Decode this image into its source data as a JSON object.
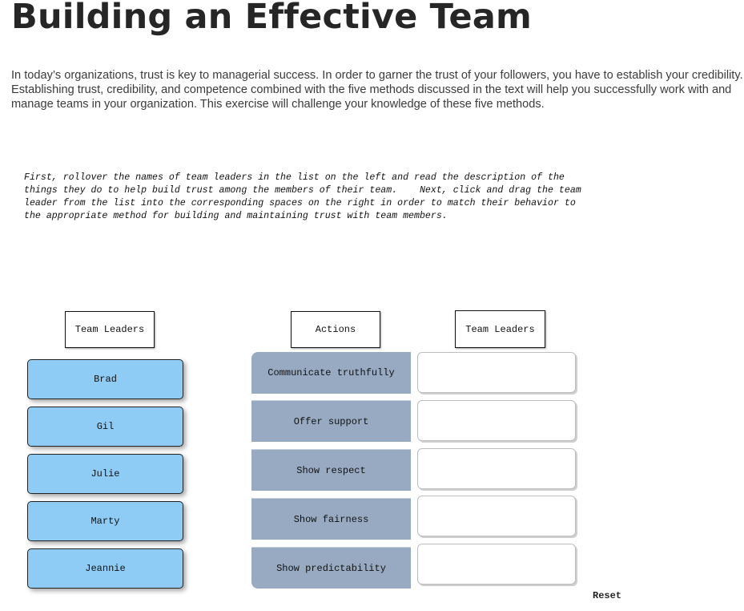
{
  "page": {
    "title": "Building an Effective Team",
    "intro": "In today’s organizations, trust is key to managerial success. In order to garner the trust of your followers, you have to establish your credibility. Establishing trust, credibility, and competence combined with the five methods discussed in the text will help you successfully work with and manage teams in your organization. This exercise will challenge your knowledge of these five methods.",
    "instructions": "First, rollover the names of team leaders in the list on the left and read the description of the\nthings they do to help build trust among the members of their team.    Next, click and drag the team\nleader from the list into the corresponding spaces on the right in order to match their behavior to\nthe appropriate method for building and maintaining trust with team members."
  },
  "exercise": {
    "headers": {
      "leaders": "Team Leaders",
      "actions": "Actions",
      "targets": "Team Leaders"
    },
    "leaders": [
      {
        "name": "Brad"
      },
      {
        "name": "Gil"
      },
      {
        "name": "Julie"
      },
      {
        "name": "Marty"
      },
      {
        "name": "Jeannie"
      }
    ],
    "actions": [
      {
        "label": "Communicate truthfully",
        "assigned": ""
      },
      {
        "label": "Offer support",
        "assigned": ""
      },
      {
        "label": "Show respect",
        "assigned": ""
      },
      {
        "label": "Show fairness",
        "assigned": ""
      },
      {
        "label": "Show predictability",
        "assigned": ""
      }
    ],
    "reset_label": "Reset"
  },
  "colors": {
    "leader_card": "#8ecbf5",
    "action_cell": "#98aac2",
    "title_text": "#262626"
  }
}
